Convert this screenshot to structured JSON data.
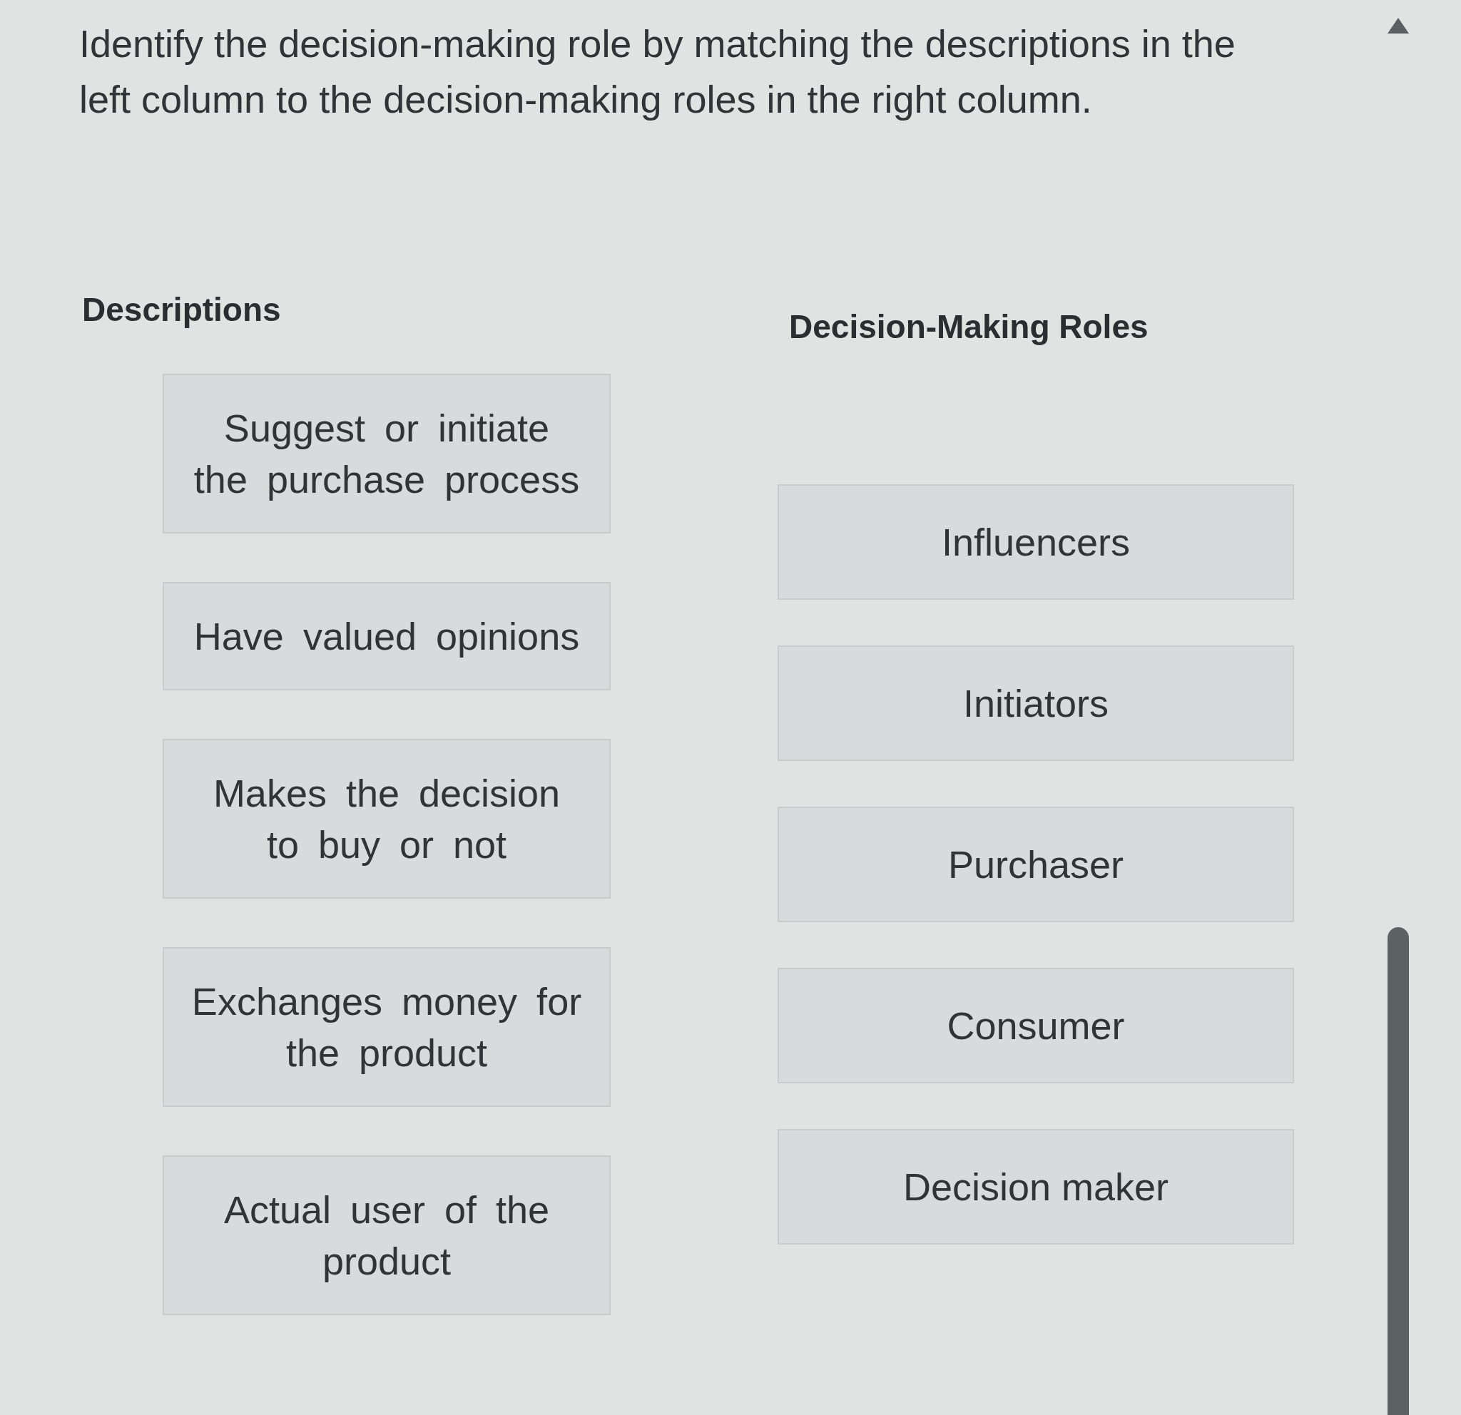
{
  "instructions": "Identify the decision-making role by matching the descriptions in the left column to the decision-making roles in the right column.",
  "descriptions": {
    "heading": "Descriptions",
    "items": [
      "Suggest or initiate the purchase process",
      "Have valued opinions",
      "Makes the decision to buy or not",
      "Exchanges money for the product",
      "Actual user of the product"
    ]
  },
  "roles": {
    "heading": "Decision-Making Roles",
    "items": [
      "Influencers",
      "Initiators",
      "Purchaser",
      "Consumer",
      "Decision maker"
    ]
  }
}
